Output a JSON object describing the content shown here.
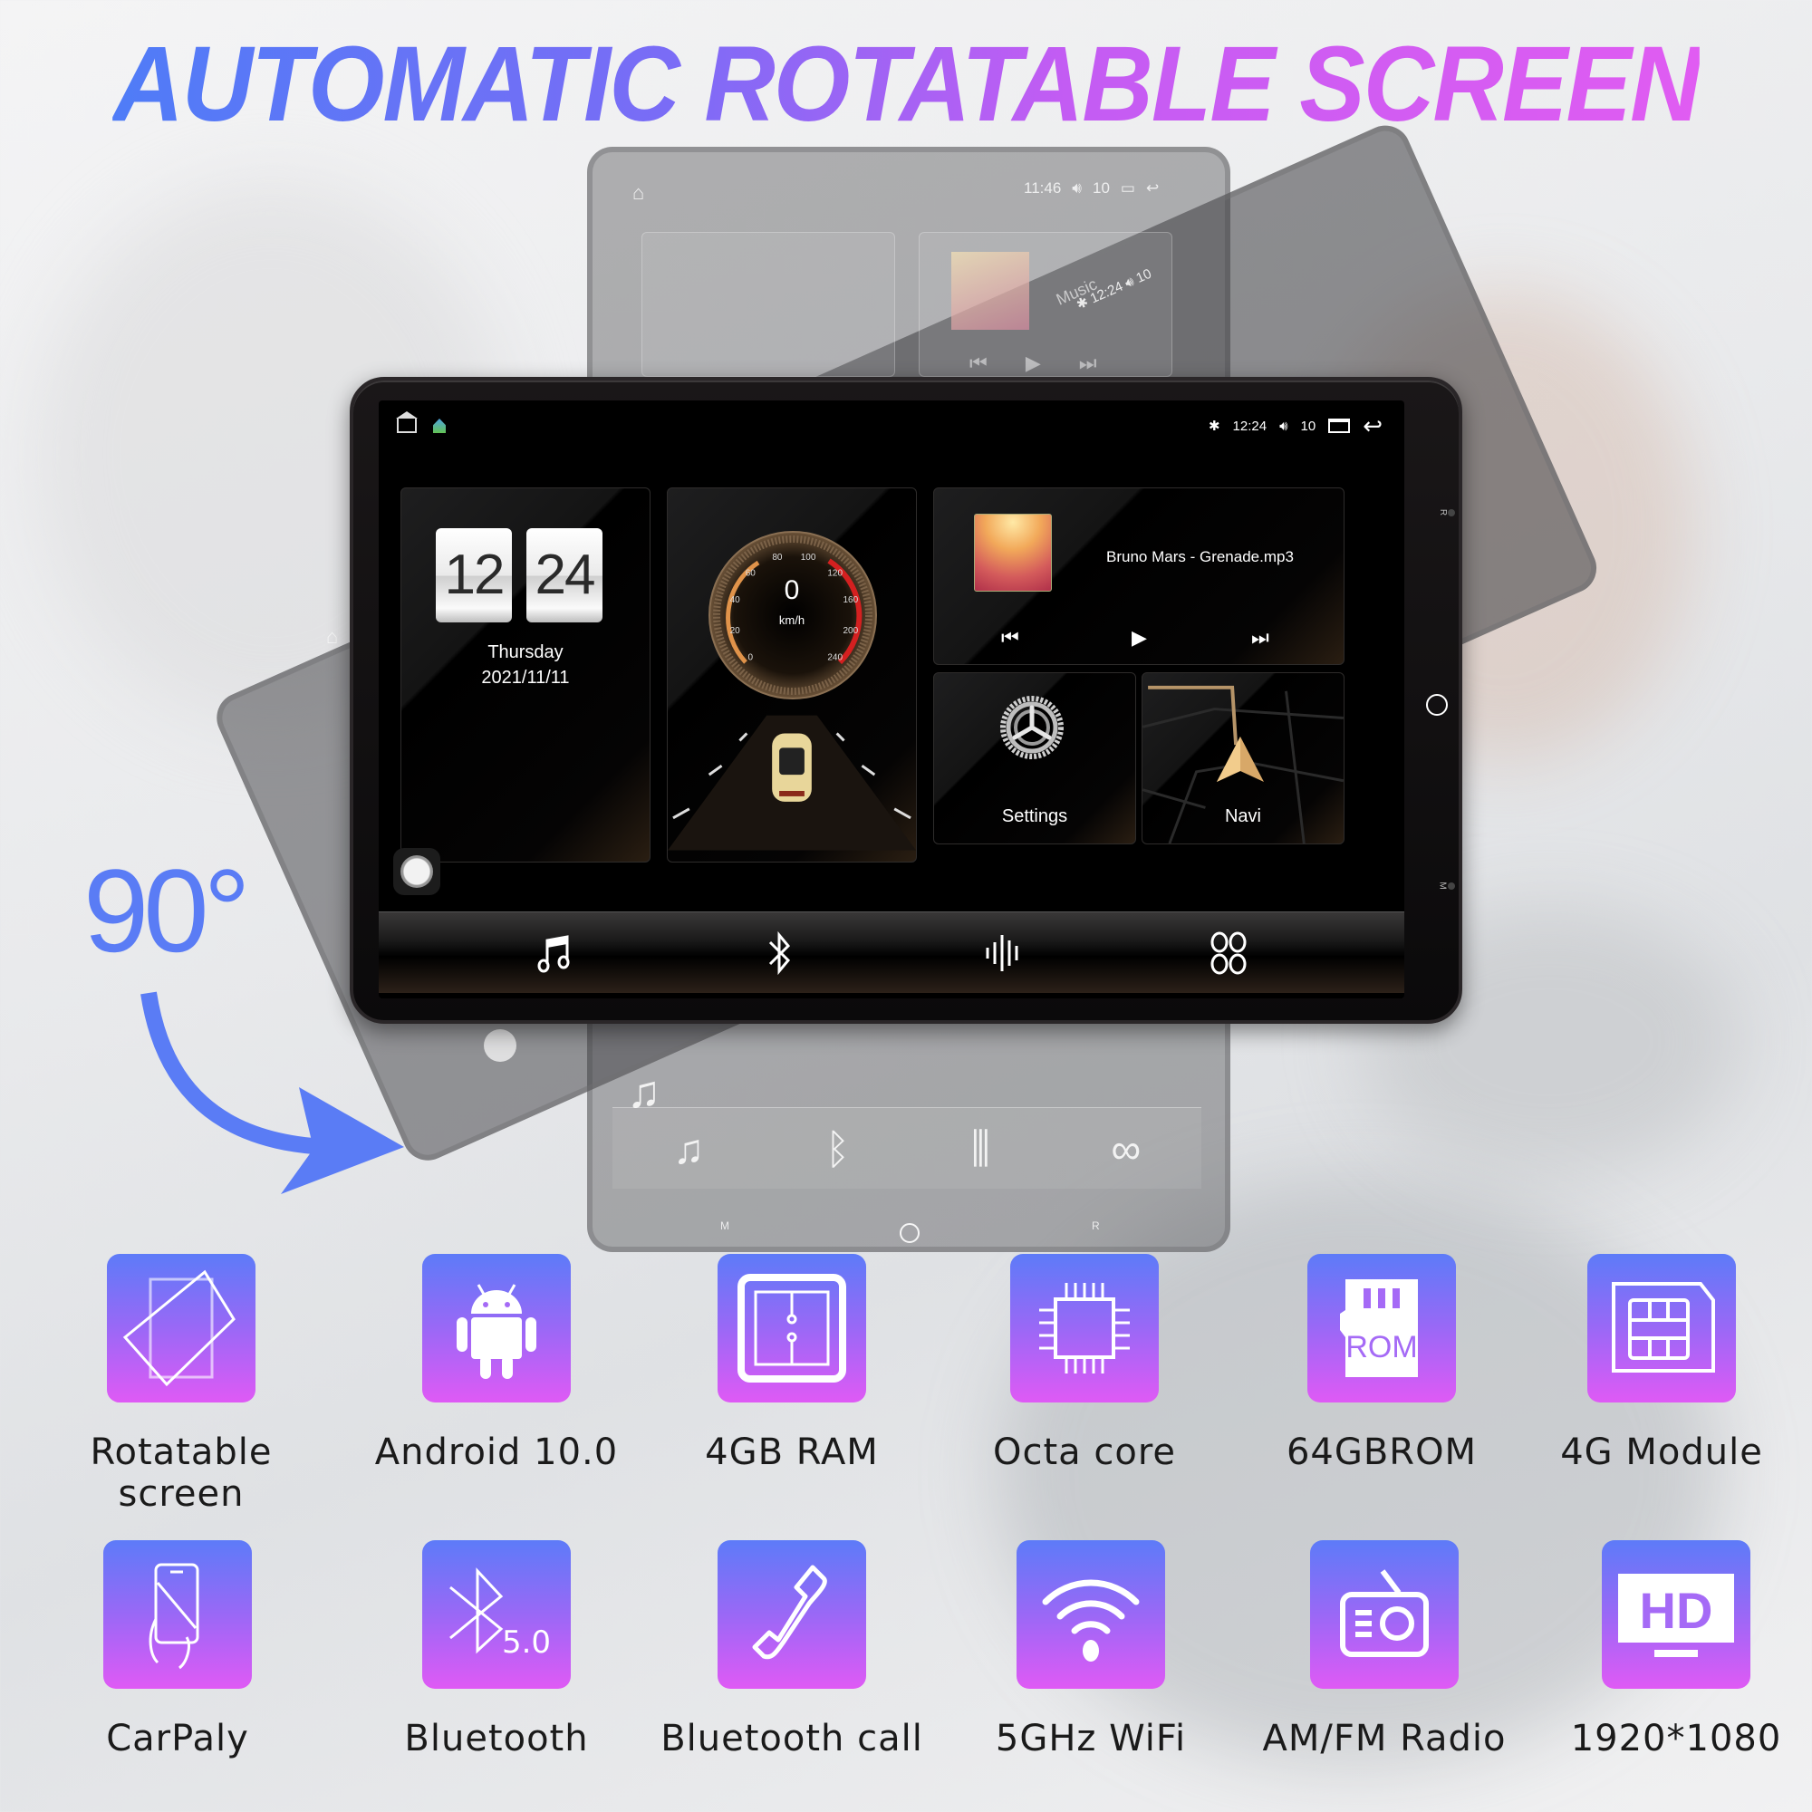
{
  "headline": "AUTOMATIC ROTATABLE SCREEN",
  "rotation_label": "90°",
  "colors": {
    "headline_gradient_start": "#4f7cf7",
    "headline_gradient_end": "#e05cf2",
    "rotation_accent": "#5a7cf5",
    "feature_icon_top": "#5d7bf8",
    "feature_icon_bottom": "#df5af5"
  },
  "ghost_screens": {
    "vertical_status": {
      "time": "11:46",
      "volume": "10"
    },
    "tilted_status": {
      "time": "12:24",
      "volume": "10"
    },
    "tilted_music_label": "Music",
    "side_buttons": [
      "M",
      "R"
    ]
  },
  "device": {
    "status_bar": {
      "time": "12:24",
      "volume": "10",
      "icons": [
        "home-icon",
        "app-icon",
        "bluetooth-icon",
        "volume-icon",
        "recents-icon",
        "back-icon"
      ]
    },
    "clock": {
      "hour": "12",
      "minute": "24",
      "day": "Thursday",
      "date": "2021/11/11"
    },
    "speedometer": {
      "value": "0",
      "unit": "km/h",
      "ticks": [
        "0",
        "20",
        "40",
        "60",
        "80",
        "100",
        "120",
        "160",
        "200",
        "240"
      ]
    },
    "music": {
      "track": "Bruno Mars - Grenade.mp3",
      "controls": [
        "previous",
        "play",
        "next"
      ]
    },
    "settings_label": "Settings",
    "navi_label": "Navi",
    "dock": [
      "music-icon",
      "bluetooth-icon",
      "equalizer-icon",
      "apps-icon"
    ],
    "side_buttons": {
      "top": "R",
      "bottom": "M"
    }
  },
  "features": [
    {
      "label": "Rotatable screen",
      "icon": "rotate-screen-icon"
    },
    {
      "label": "Android 10.0",
      "icon": "android-icon"
    },
    {
      "label": "4GB RAM",
      "icon": "ram-icon"
    },
    {
      "label": "Octa core",
      "icon": "cpu-icon"
    },
    {
      "label": "64GBROM",
      "icon": "rom-card-icon",
      "icon_text": "ROM"
    },
    {
      "label": "4G Module",
      "icon": "sim-card-icon"
    },
    {
      "label": "CarPaly",
      "icon": "phone-hand-icon"
    },
    {
      "label": "Bluetooth",
      "icon": "bluetooth-icon",
      "icon_text": "5.0"
    },
    {
      "label": "Bluetooth call",
      "icon": "phone-call-icon"
    },
    {
      "label": "5GHz WiFi",
      "icon": "wifi-icon"
    },
    {
      "label": "AM/FM Radio",
      "icon": "radio-icon"
    },
    {
      "label": "1920*1080",
      "icon": "hd-display-icon",
      "icon_text": "HD"
    }
  ]
}
